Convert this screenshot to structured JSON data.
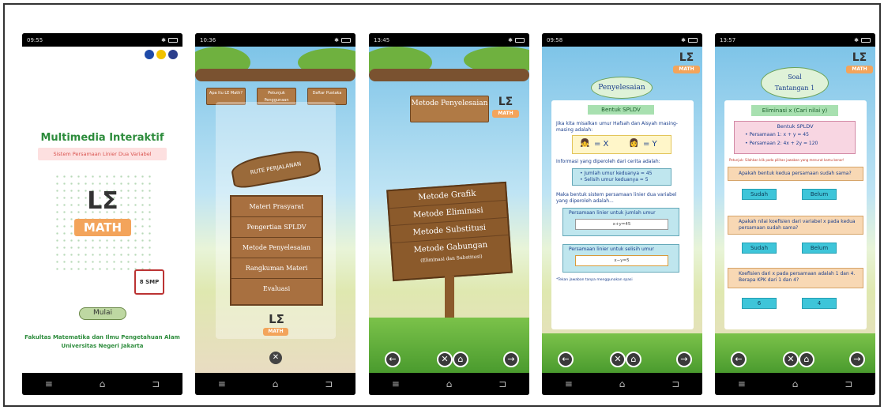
{
  "phone1": {
    "status_time": "09:55",
    "title": "Multimedia Interaktif",
    "subtitle": "Sistem Persamaan Linier Dua Variabel",
    "logo_text": "LΣ",
    "logo_math": "MATH",
    "badge": "8 SMP",
    "start_button": "Mulai",
    "footer_line1": "Fakultas Matematika dan Ilmu Pengetahuan Alam",
    "footer_line2": "Universitas Negeri Jakarta"
  },
  "phone2": {
    "status_time": "10:36",
    "top_signs": [
      "Apa Itu LE Math?",
      "Petunjuk Penggunaan",
      "Daftar Pustaka"
    ],
    "route_sign": "RUTE PERJALANAN",
    "menu": [
      "Materi Prasyarat",
      "Pengertian SPLDV",
      "Metode Penyelesaian",
      "Rangkuman Materi",
      "Evaluasi"
    ],
    "logo_text": "LΣ",
    "logo_math": "MATH"
  },
  "phone3": {
    "status_time": "13:45",
    "sign": "Metode Penyelesaian",
    "methods": [
      "Metode Grafik",
      "Metode Eliminasi",
      "Metode Substitusi",
      "Metode Gabungan"
    ],
    "methods_note": "(Eliminasi dan Substitusi)",
    "logo_text": "LΣ",
    "logo_math": "MATH"
  },
  "phone4": {
    "status_time": "09:58",
    "header": "Penyelesaian",
    "tag": "Bentuk SPLDV",
    "intro": "Jika kita misalkan umur Hafsah dan Aisyah masing-masing adalah:",
    "var_x": "= X",
    "var_y": "= Y",
    "info": "Informasi yang diperoleh dari cerita adalah:",
    "fact1": "• Jumlah umur keduanya = 45",
    "fact2": "• Selisih umur keduanya = 5",
    "result": "Maka bentuk sistem persamaan linier dua variabel yang diperoleh adalah...",
    "eq1_label": "Persamaan linier untuk jumlah umur",
    "eq1_value": "x+y=45",
    "eq2_label": "Persamaan linier untuk selisih umur",
    "eq2_value": "x−y=5",
    "note": "*Tekan jawaban tanpa menggunakan spasi",
    "logo_text": "LΣ",
    "logo_math": "MATH"
  },
  "phone5": {
    "status_time": "13:57",
    "header_line1": "Soal",
    "header_line2": "Tantangan 1",
    "tag": "Eliminasi x (Cari nilai y)",
    "form_title": "Bentuk SPLDV",
    "eq1": "• Persamaan 1:   x + y = 45",
    "eq2": "• Persamaan 2:   4x + 2y = 120",
    "hint": "Petunjuk: Silahkan klik pada pilihan jawaban yang menurut kamu benar!",
    "q1": "Apakah bentuk kedua persamaan sudah sama?",
    "q1_opts": [
      "Sudah",
      "Belum"
    ],
    "q2": "Apakah nilai koefisien dari variabel x pada kedua persamaan sudah sama?",
    "q2_opts": [
      "Sudah",
      "Belum"
    ],
    "q3": "Koefisien dari x pada persamaan adalah 1 dan 4. Berapa KPK dari 1 dan 4?",
    "q3_opts": [
      "6",
      "4"
    ],
    "logo_text": "LΣ",
    "logo_math": "MATH"
  }
}
